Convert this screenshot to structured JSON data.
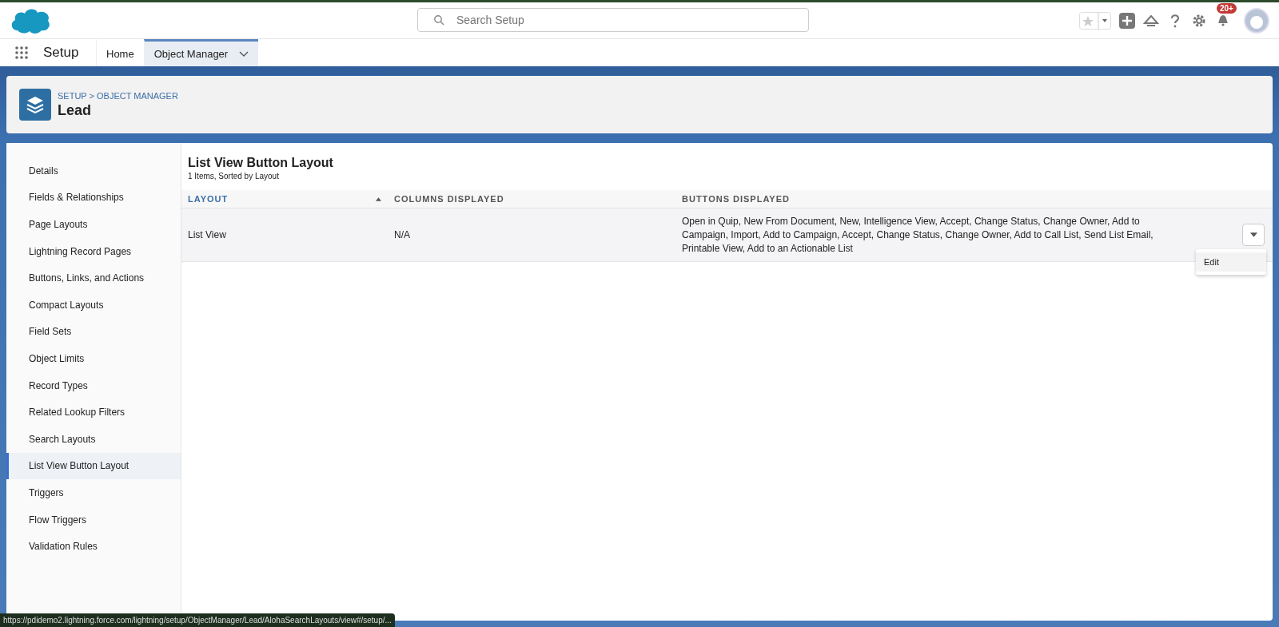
{
  "header": {
    "search": {
      "placeholder": "Search Setup"
    },
    "notifications_badge": "20+"
  },
  "nav": {
    "app_name": "Setup",
    "tabs": [
      {
        "label": "Home",
        "selected": false,
        "has_menu": false
      },
      {
        "label": "Object Manager",
        "selected": true,
        "has_menu": true
      }
    ]
  },
  "page_header": {
    "breadcrumb": "SETUP > OBJECT MANAGER",
    "title": "Lead"
  },
  "sidebar": {
    "items": [
      {
        "label": "Details",
        "selected": false
      },
      {
        "label": "Fields & Relationships",
        "selected": false
      },
      {
        "label": "Page Layouts",
        "selected": false
      },
      {
        "label": "Lightning Record Pages",
        "selected": false
      },
      {
        "label": "Buttons, Links, and Actions",
        "selected": false
      },
      {
        "label": "Compact Layouts",
        "selected": false
      },
      {
        "label": "Field Sets",
        "selected": false
      },
      {
        "label": "Object Limits",
        "selected": false
      },
      {
        "label": "Record Types",
        "selected": false
      },
      {
        "label": "Related Lookup Filters",
        "selected": false
      },
      {
        "label": "Search Layouts",
        "selected": false
      },
      {
        "label": "List View Button Layout",
        "selected": true
      },
      {
        "label": "Triggers",
        "selected": false
      },
      {
        "label": "Flow Triggers",
        "selected": false
      },
      {
        "label": "Validation Rules",
        "selected": false
      }
    ]
  },
  "content": {
    "title": "List View Button Layout",
    "subtitle": "1 Items, Sorted by Layout",
    "table": {
      "columns": [
        {
          "label": "LAYOUT",
          "sorted": true
        },
        {
          "label": "COLUMNS DISPLAYED",
          "sorted": false
        },
        {
          "label": "BUTTONS DISPLAYED",
          "sorted": false
        }
      ],
      "rows": [
        {
          "cells": [
            "List View",
            "N/A",
            "Open in Quip, New From Document, New, Intelligence View, Accept, Change Status, Change Owner, Add to Campaign, Import, Add to Campaign, Accept, Change Status, Change Owner, Add to Call List, Send List Email, Printable View, Add to an Actionable List"
          ]
        }
      ]
    },
    "row_menu": {
      "items": [
        "Edit"
      ]
    }
  },
  "status_url": "https://pdidemo2.lightning.force.com/lightning/setup/ObjectManager/Lead/AlohaSearchLayouts/view#/setup/..."
}
